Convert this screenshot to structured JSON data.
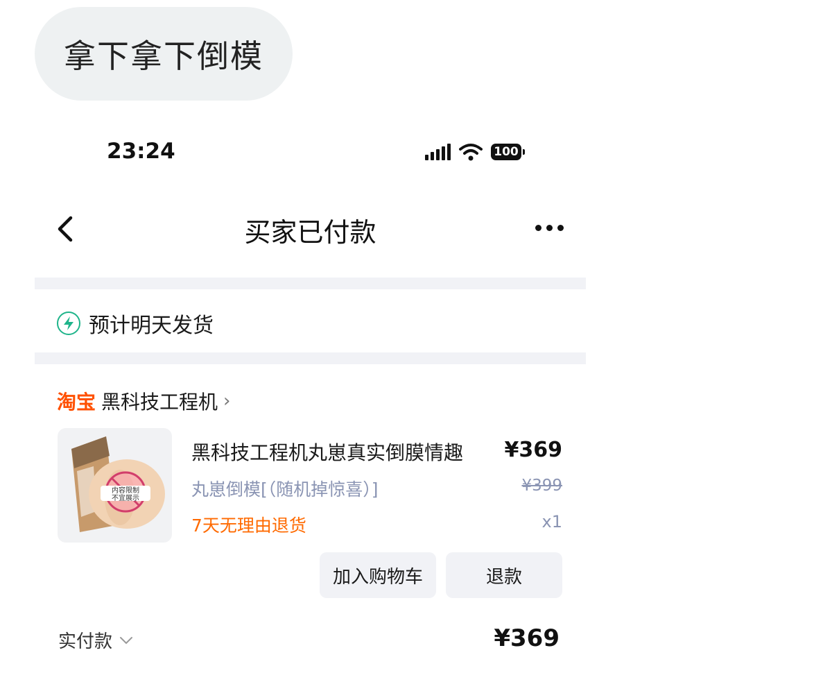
{
  "message": {
    "text": "拿下拿下倒模"
  },
  "status_bar": {
    "time": "23:24",
    "battery": "100"
  },
  "nav": {
    "title": "买家已付款"
  },
  "shipping": {
    "text": "预计明天发货"
  },
  "shop": {
    "logo": "淘宝",
    "name": "黑科技工程机"
  },
  "product": {
    "title": "黑科技工程机丸崽真实倒膜情趣",
    "spec": "丸崽倒模[（随机掉惊喜）]",
    "return_policy": "7天无理由退货",
    "price": "¥369",
    "original_price": "¥399",
    "quantity": "x1",
    "badge_line1": "内容限制",
    "badge_line2": "不宜展示"
  },
  "actions": {
    "add_cart": "加入购物车",
    "refund": "退款"
  },
  "total": {
    "label": "实付款",
    "value": "¥369"
  },
  "colors": {
    "accent_green": "#1eb48a",
    "taobao_orange": "#ff5000",
    "return_orange": "#ff6a00",
    "muted_blue": "#8a94b3"
  }
}
